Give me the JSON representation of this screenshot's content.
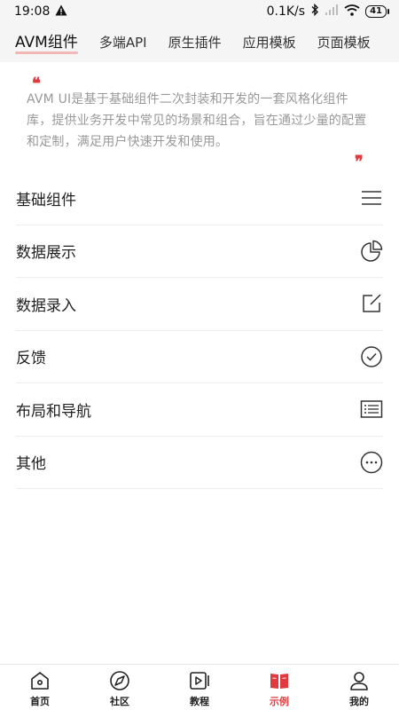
{
  "status_bar": {
    "time": "19:08",
    "network_speed": "0.1K/s",
    "battery": "41"
  },
  "tabs": [
    {
      "label": "AVM组件",
      "active": true
    },
    {
      "label": "多端API",
      "active": false
    },
    {
      "label": "原生插件",
      "active": false
    },
    {
      "label": "应用模板",
      "active": false
    },
    {
      "label": "页面模板",
      "active": false
    }
  ],
  "intro": {
    "quote_open": "❝",
    "quote_close": "❞",
    "text": "AVM UI是基于基础组件二次封装和开发的一套风格化组件库，提供业务开发中常见的场景和组合，旨在通过少量的配置和定制，满足用户快速开发和使用。"
  },
  "menu": [
    {
      "label": "基础组件",
      "icon": "menu-lines-icon"
    },
    {
      "label": "数据展示",
      "icon": "pie-chart-icon"
    },
    {
      "label": "数据录入",
      "icon": "edit-icon"
    },
    {
      "label": "反馈",
      "icon": "check-circle-icon"
    },
    {
      "label": "布局和导航",
      "icon": "list-icon"
    },
    {
      "label": "其他",
      "icon": "more-circle-icon"
    }
  ],
  "bottom_nav": [
    {
      "label": "首页",
      "icon": "home-icon",
      "active": false
    },
    {
      "label": "社区",
      "icon": "compass-icon",
      "active": false
    },
    {
      "label": "教程",
      "icon": "video-icon",
      "active": false
    },
    {
      "label": "示例",
      "icon": "book-icon",
      "active": true
    },
    {
      "label": "我的",
      "icon": "user-icon",
      "active": false
    }
  ],
  "colors": {
    "accent": "#e0393e",
    "tab_underline": "#f2b8b8",
    "intro_text": "#999999",
    "header_bg": "#f5f5f5"
  }
}
